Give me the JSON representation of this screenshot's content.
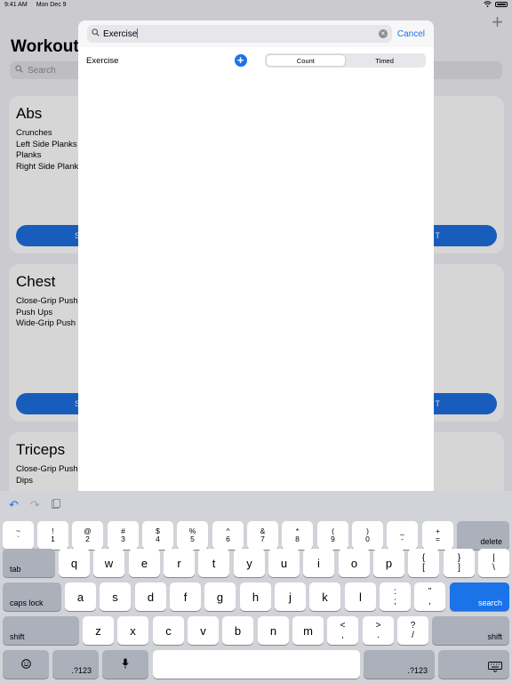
{
  "status": {
    "time": "9:41 AM",
    "date": "Mon Dec 9"
  },
  "background": {
    "title": "Workouts",
    "search_placeholder": "Search",
    "cards": [
      {
        "name": "Abs",
        "exercises": [
          "Crunches",
          "Left Side Planks",
          "Planks",
          "Right Side Plank"
        ],
        "button_left": "S",
        "button_right": "T"
      },
      {
        "name": "Chest",
        "exercises": [
          "Close-Grip Push",
          "Push Ups",
          "Wide-Grip Push"
        ],
        "button_left": "S",
        "button_right": "T"
      },
      {
        "name": "Triceps",
        "exercises": [
          "Close-Grip Push",
          "Dips"
        ]
      }
    ]
  },
  "modal": {
    "search_value": "Exercise",
    "cancel_label": "Cancel",
    "row_label": "Exercise",
    "segments": [
      "Count",
      "Timed"
    ],
    "selected_segment": "Count"
  },
  "keyboard": {
    "number_row": [
      [
        "~",
        "`"
      ],
      [
        "!",
        "1"
      ],
      [
        "@",
        "2"
      ],
      [
        "#",
        "3"
      ],
      [
        "$",
        "4"
      ],
      [
        "%",
        "5"
      ],
      [
        "^",
        "6"
      ],
      [
        "&",
        "7"
      ],
      [
        "*",
        "8"
      ],
      [
        "(",
        "9"
      ],
      [
        ")",
        "0"
      ],
      [
        "_",
        "-"
      ],
      [
        "+",
        "="
      ]
    ],
    "delete": "delete",
    "tab": "tab",
    "row_q": [
      "q",
      "w",
      "e",
      "r",
      "t",
      "y",
      "u",
      "i",
      "o",
      "p"
    ],
    "row_q_sym": [
      [
        "{",
        "["
      ],
      [
        "}",
        "]"
      ],
      [
        "|",
        "\\"
      ]
    ],
    "caps": "caps lock",
    "row_a": [
      "a",
      "s",
      "d",
      "f",
      "g",
      "h",
      "j",
      "k",
      "l"
    ],
    "row_a_sym": [
      [
        ":",
        ";"
      ],
      [
        "”",
        ","
      ]
    ],
    "search": "search",
    "shift": "shift",
    "row_z": [
      "z",
      "x",
      "c",
      "v",
      "b",
      "n",
      "m"
    ],
    "row_z_sym": [
      [
        "<",
        ","
      ],
      [
        ">",
        "."
      ],
      [
        "?",
        "/"
      ]
    ],
    "numkey": ".?123"
  }
}
